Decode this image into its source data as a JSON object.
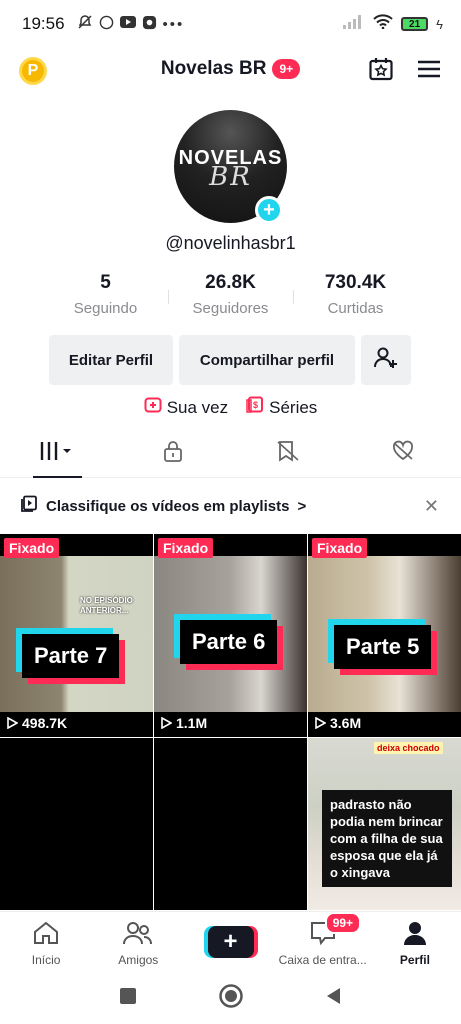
{
  "status": {
    "time": "19:56",
    "battery": "21"
  },
  "header": {
    "title": "Novelas BR",
    "badge": "9+",
    "coin_letter": "P"
  },
  "profile": {
    "avatar_line1": "NOVELAS",
    "avatar_line2": "BR",
    "username": "@novelinhasbr1",
    "stats": [
      {
        "value": "5",
        "label": "Seguindo"
      },
      {
        "value": "26.8K",
        "label": "Seguidores"
      },
      {
        "value": "730.4K",
        "label": "Curtidas"
      }
    ],
    "edit_button": "Editar Perfil",
    "share_button": "Compartilhar perfil",
    "links": {
      "sua_vez": "Sua vez",
      "series": "Séries"
    }
  },
  "playlist_banner": {
    "text": "Classifique os vídeos em playlists",
    "chevron": ">"
  },
  "videos": [
    {
      "pinned": "Fixado",
      "part": "Parte 7",
      "views": "498.7K",
      "overlay": "NO EPISÓDIO ANTERIOR..."
    },
    {
      "pinned": "Fixado",
      "part": "Parte 6",
      "views": "1.1M"
    },
    {
      "pinned": "Fixado",
      "part": "Parte 5",
      "views": "3.6M"
    },
    {
      "caption": "padrasto não podia nem brincar com a filha de sua esposa que ela já o xingava",
      "tag": "deixa chocado"
    }
  ],
  "nav": {
    "home": "Início",
    "friends": "Amigos",
    "inbox": "Caixa de entra...",
    "inbox_badge": "99+",
    "profile": "Perfil"
  },
  "colors": {
    "accent": "#fe2c55",
    "cyan": "#20d5ec"
  }
}
